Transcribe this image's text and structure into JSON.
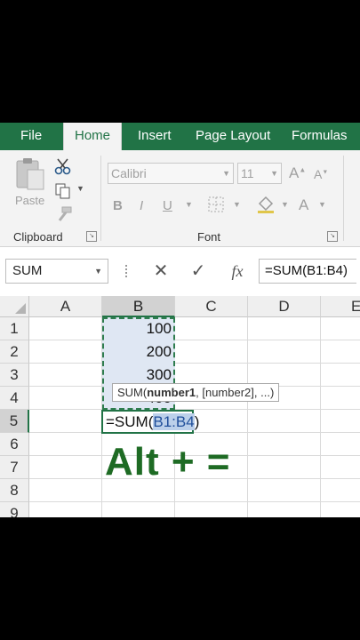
{
  "tabs": [
    "File",
    "Home",
    "Insert",
    "Page Layout",
    "Formulas"
  ],
  "active_tab": "Home",
  "ribbon": {
    "clipboard": {
      "paste_label": "Paste",
      "group_label": "Clipboard"
    },
    "font": {
      "font_name": "Calibri",
      "font_size": "11",
      "group_label": "Font",
      "bold": "B",
      "italic": "I",
      "underline": "U",
      "grow": "A",
      "shrink": "A",
      "font_color": "A"
    }
  },
  "formula_bar": {
    "name_box": "SUM",
    "formula": "=SUM(B1:B4)",
    "fx_label": "fx"
  },
  "grid": {
    "columns": [
      "A",
      "B",
      "C",
      "D",
      "E"
    ],
    "rows": [
      "1",
      "2",
      "3",
      "4",
      "5",
      "6",
      "7",
      "8",
      "9"
    ],
    "cells": {
      "B1": "100",
      "B2": "200",
      "B3": "300",
      "B4": "400"
    },
    "active_cell_edit": {
      "prefix": "=SUM(",
      "reference": "B1:B4",
      "suffix": ")"
    }
  },
  "tooltip": {
    "func": "SUM(",
    "arg1": "number1",
    "rest": ", [number2], ...)"
  },
  "overlay_text": "Alt + =",
  "colors": {
    "excel_green": "#217346",
    "range_fill": "#dfe7f3",
    "overlay_green": "#1e6b24"
  }
}
